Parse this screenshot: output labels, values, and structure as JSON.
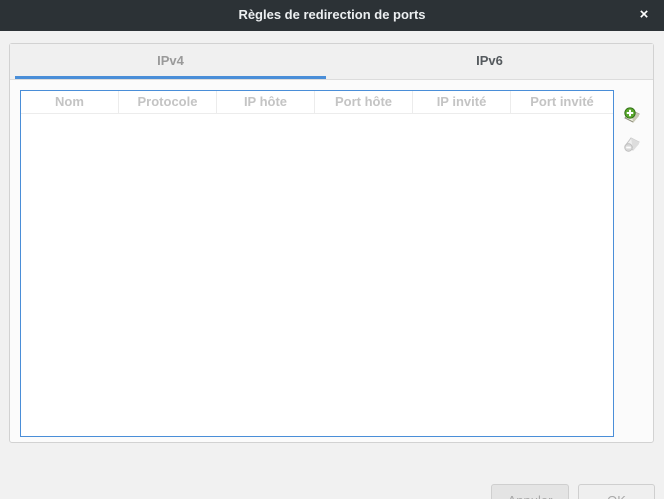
{
  "window": {
    "title": "Règles de redirection de ports",
    "close_glyph": "×",
    "close_icon": "close-icon"
  },
  "tabs": [
    {
      "label": "IPv4",
      "selected": true
    },
    {
      "label": "IPv6",
      "selected": false
    }
  ],
  "table": {
    "columns": [
      "Nom",
      "Protocole",
      "IP hôte",
      "Port hôte",
      "IP invité",
      "Port invité"
    ],
    "rows": []
  },
  "tools": {
    "add_icon": "add-rule-icon",
    "remove_icon": "remove-rule-icon"
  },
  "buttons": {
    "cancel_label": "Annuler",
    "ok_label": "OK"
  },
  "colors": {
    "titlebar": "#2c3236",
    "accent": "#4a8ed8",
    "add_icon_green": "#5aa82c"
  }
}
